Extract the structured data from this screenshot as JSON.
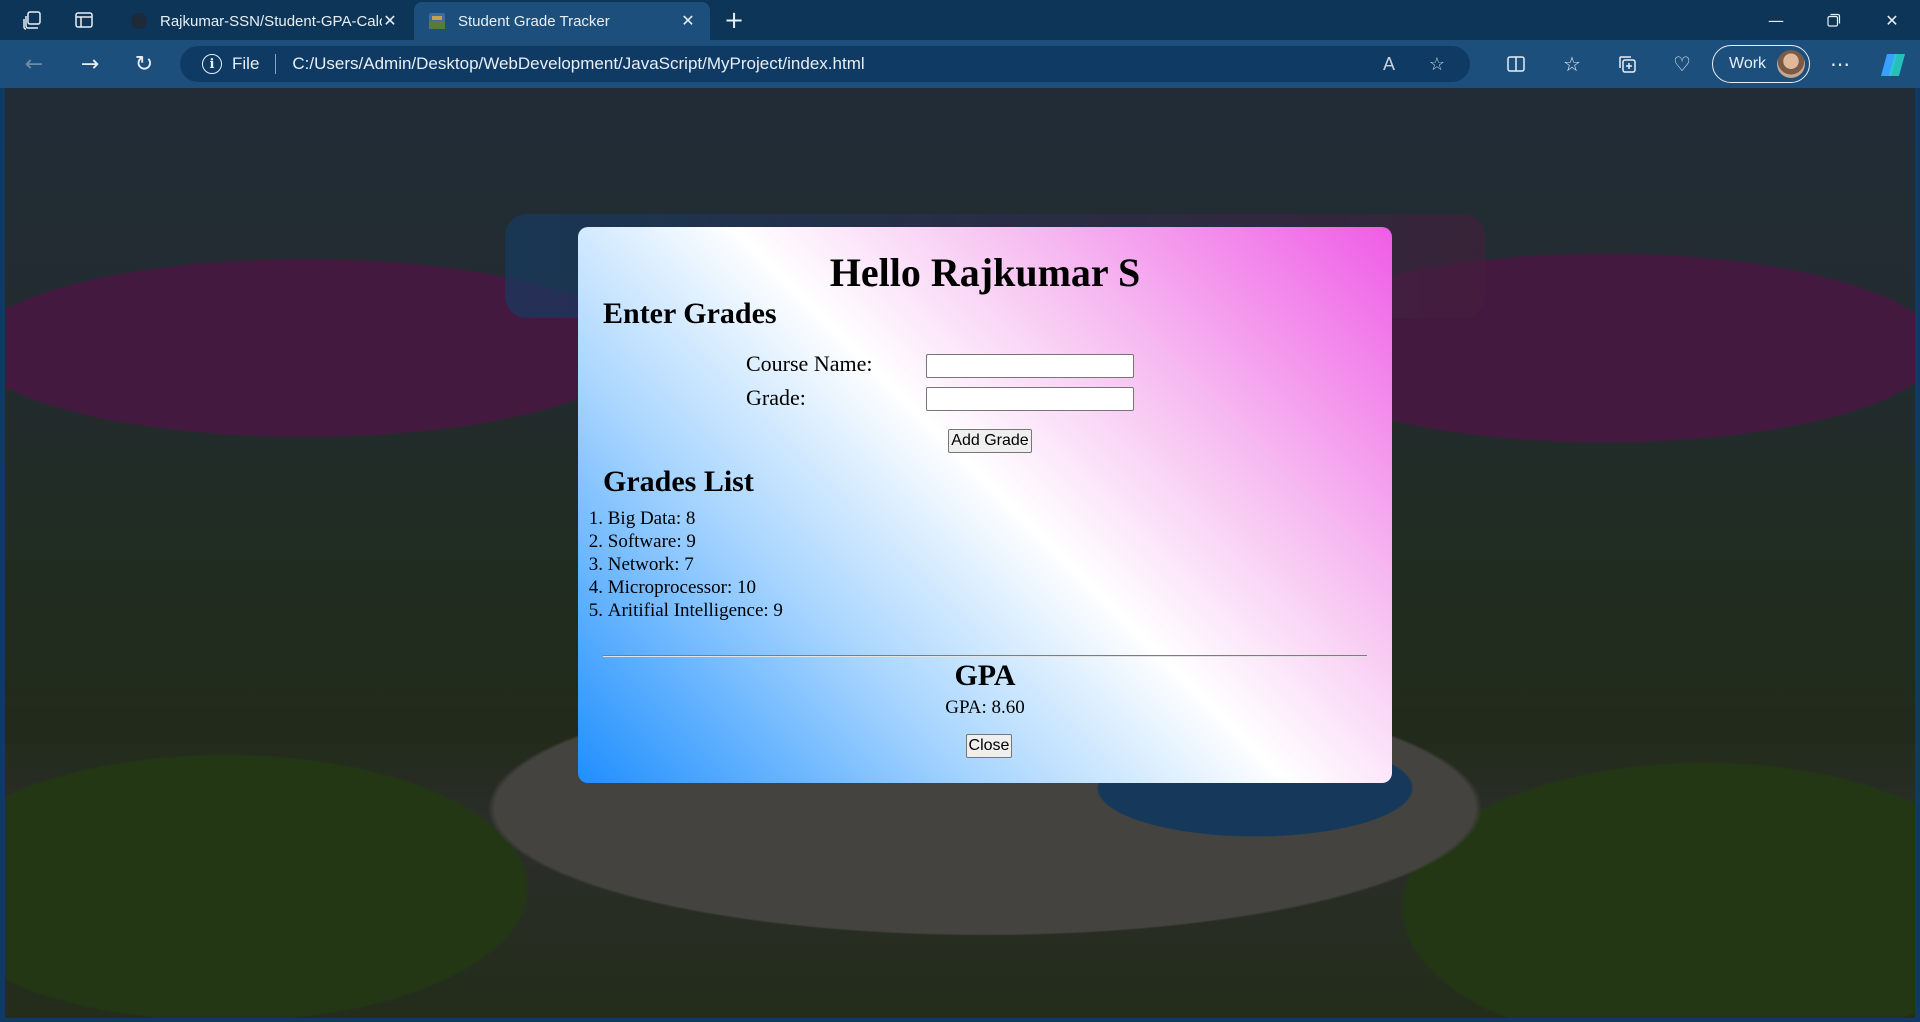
{
  "browser": {
    "tabs": [
      {
        "title": "Rajkumar-SSN/Student-GPA-Calc",
        "active": false
      },
      {
        "title": "Student Grade Tracker",
        "active": true
      }
    ],
    "address": {
      "scheme": "File",
      "url": "C:/Users/Admin/Desktop/WebDevelopment/JavaScript/MyProject/index.html"
    },
    "profile_label": "Work",
    "icons": [
      "workspaces-icon",
      "tab-actions-icon",
      "back-icon",
      "forward-icon",
      "refresh-icon",
      "info-icon",
      "read-aloud-icon",
      "favorite-star-icon",
      "split-screen-icon",
      "favorites-icon",
      "collections-icon",
      "browser-essentials-icon",
      "more-icon",
      "copilot-icon"
    ]
  },
  "modal": {
    "greeting": "Hello Rajkumar S",
    "enter_heading": "Enter Grades",
    "course_label": "Course Name:",
    "course_value": "",
    "grade_label": "Grade:",
    "grade_value": "",
    "add_button": "Add Grade",
    "list_heading": "Grades List",
    "grades": [
      {
        "num": "1.",
        "text": "Big Data: 8"
      },
      {
        "num": "2.",
        "text": "Software: 9"
      },
      {
        "num": "3.",
        "text": "Network: 7"
      },
      {
        "num": "4.",
        "text": "Microprocessor: 10"
      },
      {
        "num": "5.",
        "text": "Aritifial Intelligence: 9"
      }
    ],
    "gpa_heading": "GPA",
    "gpa_text": "GPA: 8.60",
    "close_button": "Close"
  },
  "colors": {
    "chrome_dark": "#0d3557",
    "chrome_light": "#1c4f7c",
    "modal_gradient_start": "#1f8fff",
    "modal_gradient_end": "#ef5ce6"
  }
}
